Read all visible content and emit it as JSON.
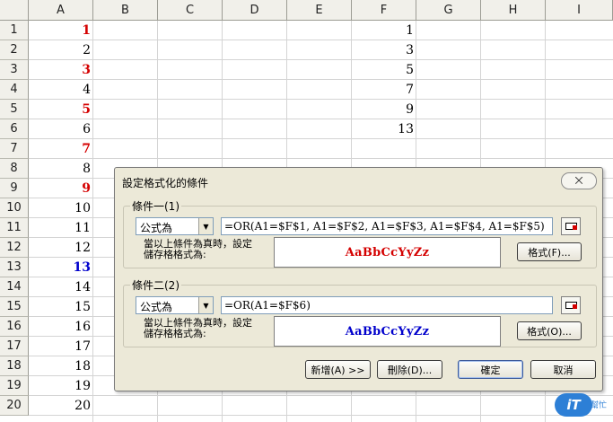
{
  "sheet": {
    "columns": [
      "A",
      "B",
      "C",
      "D",
      "E",
      "F",
      "G",
      "H",
      "I"
    ],
    "rows": [
      "1",
      "2",
      "3",
      "4",
      "5",
      "6",
      "7",
      "8",
      "9",
      "10",
      "11",
      "12",
      "13",
      "14",
      "15",
      "16",
      "17",
      "18",
      "19",
      "20"
    ],
    "colA": [
      {
        "v": "1",
        "s": "red"
      },
      {
        "v": "2",
        "s": ""
      },
      {
        "v": "3",
        "s": "red"
      },
      {
        "v": "4",
        "s": ""
      },
      {
        "v": "5",
        "s": "red"
      },
      {
        "v": "6",
        "s": ""
      },
      {
        "v": "7",
        "s": "red"
      },
      {
        "v": "8",
        "s": ""
      },
      {
        "v": "9",
        "s": "red"
      },
      {
        "v": "10",
        "s": ""
      },
      {
        "v": "11",
        "s": ""
      },
      {
        "v": "12",
        "s": ""
      },
      {
        "v": "13",
        "s": "blue"
      },
      {
        "v": "14",
        "s": ""
      },
      {
        "v": "15",
        "s": ""
      },
      {
        "v": "16",
        "s": ""
      },
      {
        "v": "17",
        "s": ""
      },
      {
        "v": "18",
        "s": ""
      },
      {
        "v": "19",
        "s": ""
      },
      {
        "v": "20",
        "s": ""
      }
    ],
    "colF": [
      "1",
      "3",
      "5",
      "7",
      "9",
      "13"
    ]
  },
  "dialog": {
    "title": "設定格式化的條件",
    "close_label": "⨉",
    "cond1": {
      "label": "條件一(1)",
      "type": "公式為",
      "formula": "=OR(A1=$F$1, A1=$F$2, A1=$F$3, A1=$F$4, A1=$F$5)",
      "desc_line1": "當以上條件為真時，設定",
      "desc_line2": "儲存格格式為:",
      "preview": "AaBbCcYyZz",
      "format_button": "格式(F)..."
    },
    "cond2": {
      "label": "條件二(2)",
      "type": "公式為",
      "formula": "=OR(A1=$F$6)",
      "desc_line1": "當以上條件為真時，設定",
      "desc_line2": "儲存格格式為:",
      "preview": "AaBbCcYyZz",
      "format_button": "格式(O)..."
    },
    "buttons": {
      "add": "新增(A) >>",
      "delete": "刪除(D)...",
      "ok": "確定",
      "cancel": "取消"
    }
  },
  "colors": {
    "red": "#d40000",
    "blue": "#0000cc",
    "dialog_bg": "#ece9d8",
    "header_bg": "#f1f0ea"
  },
  "logo": {
    "text": "iT",
    "sub": "幫忙"
  }
}
